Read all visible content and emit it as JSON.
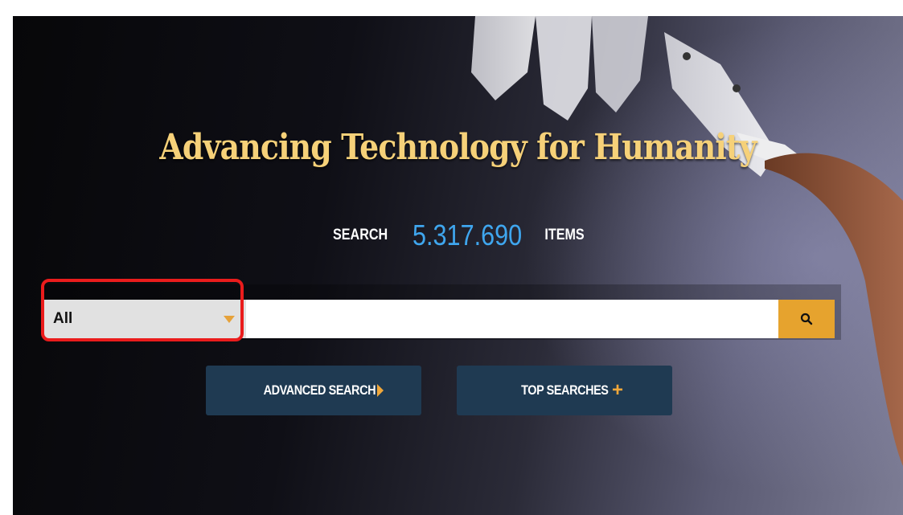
{
  "hero": {
    "title": "Advancing Technology for Humanity",
    "search_word": "SEARCH",
    "item_count": "5.317.690",
    "items_word": "ITEMS"
  },
  "search": {
    "category_selected": "All",
    "query": "",
    "submit_icon": "search-icon"
  },
  "buttons": {
    "advanced_label": "ADVANCED SEARCH",
    "advanced_icon": "triangle-right-icon",
    "top_label": "TOP SEARCHES",
    "top_icon": "plus-icon"
  },
  "colors": {
    "title": "#f6d179",
    "count": "#3fa6ee",
    "accent": "#e6a32e",
    "button_bg": "#1f3a52",
    "highlight": "#ea1c1c"
  }
}
